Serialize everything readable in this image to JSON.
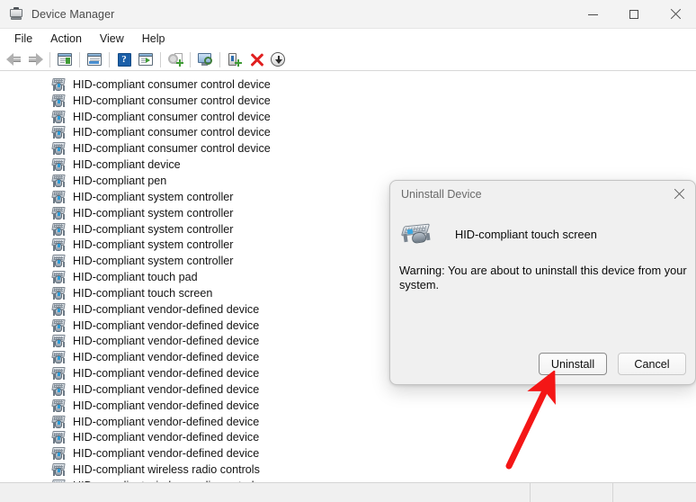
{
  "window": {
    "title": "Device Manager",
    "icon": "device-manager-icon",
    "controls": {
      "minimize": "minimize-icon",
      "maximize": "maximize-icon",
      "close": "close-icon"
    }
  },
  "menubar": {
    "items": [
      {
        "label": "File"
      },
      {
        "label": "Action"
      },
      {
        "label": "View"
      },
      {
        "label": "Help"
      }
    ]
  },
  "toolbar": {
    "buttons": [
      {
        "name": "back-arrow-icon",
        "title": "Back"
      },
      {
        "name": "forward-arrow-icon",
        "title": "Forward"
      },
      {
        "name": "show-hide-console-tree-icon",
        "title": "Show/Hide Console Tree"
      },
      {
        "name": "properties-icon",
        "title": "Properties"
      },
      {
        "name": "help-icon",
        "title": "Help"
      },
      {
        "name": "show-hide-action-pane-icon",
        "title": "Show/Hide Action Pane"
      },
      {
        "name": "update-driver-icon",
        "title": "Update Driver Software"
      },
      {
        "name": "scan-for-hardware-changes-icon",
        "title": "Scan for hardware changes"
      },
      {
        "name": "enable-device-icon",
        "title": "Enable device"
      },
      {
        "name": "uninstall-device-icon",
        "title": "Uninstall device"
      },
      {
        "name": "disable-device-icon",
        "title": "Disable device"
      }
    ]
  },
  "devices": [
    {
      "label": "HID-compliant consumer control device"
    },
    {
      "label": "HID-compliant consumer control device"
    },
    {
      "label": "HID-compliant consumer control device"
    },
    {
      "label": "HID-compliant consumer control device"
    },
    {
      "label": "HID-compliant consumer control device"
    },
    {
      "label": "HID-compliant device"
    },
    {
      "label": "HID-compliant pen"
    },
    {
      "label": "HID-compliant system controller"
    },
    {
      "label": "HID-compliant system controller"
    },
    {
      "label": "HID-compliant system controller"
    },
    {
      "label": "HID-compliant system controller"
    },
    {
      "label": "HID-compliant system controller"
    },
    {
      "label": "HID-compliant touch pad"
    },
    {
      "label": "HID-compliant touch screen"
    },
    {
      "label": "HID-compliant vendor-defined device"
    },
    {
      "label": "HID-compliant vendor-defined device"
    },
    {
      "label": "HID-compliant vendor-defined device"
    },
    {
      "label": "HID-compliant vendor-defined device"
    },
    {
      "label": "HID-compliant vendor-defined device"
    },
    {
      "label": "HID-compliant vendor-defined device"
    },
    {
      "label": "HID-compliant vendor-defined device"
    },
    {
      "label": "HID-compliant vendor-defined device"
    },
    {
      "label": "HID-compliant vendor-defined device"
    },
    {
      "label": "HID-compliant vendor-defined device"
    },
    {
      "label": "HID-compliant wireless radio controls"
    },
    {
      "label": "HID-compliant wireless radio controls"
    }
  ],
  "statusbar": {
    "text": ""
  },
  "dialog": {
    "title": "Uninstall Device",
    "close_icon": "close-icon",
    "device_icon": "hid-device-icon",
    "device_name": "HID-compliant touch screen",
    "warning": "Warning: You are about to uninstall this device from your system.",
    "buttons": {
      "confirm": "Uninstall",
      "cancel": "Cancel"
    }
  },
  "annotation": {
    "arrow_color": "#f41616",
    "arrow_target": "uninstall-button"
  },
  "colors": {
    "titlebar_bg": "#f3f3f3",
    "content_bg": "#ffffff",
    "dialog_bg": "#f0f0f0",
    "text": "#141414",
    "accent_red": "#e02020"
  }
}
